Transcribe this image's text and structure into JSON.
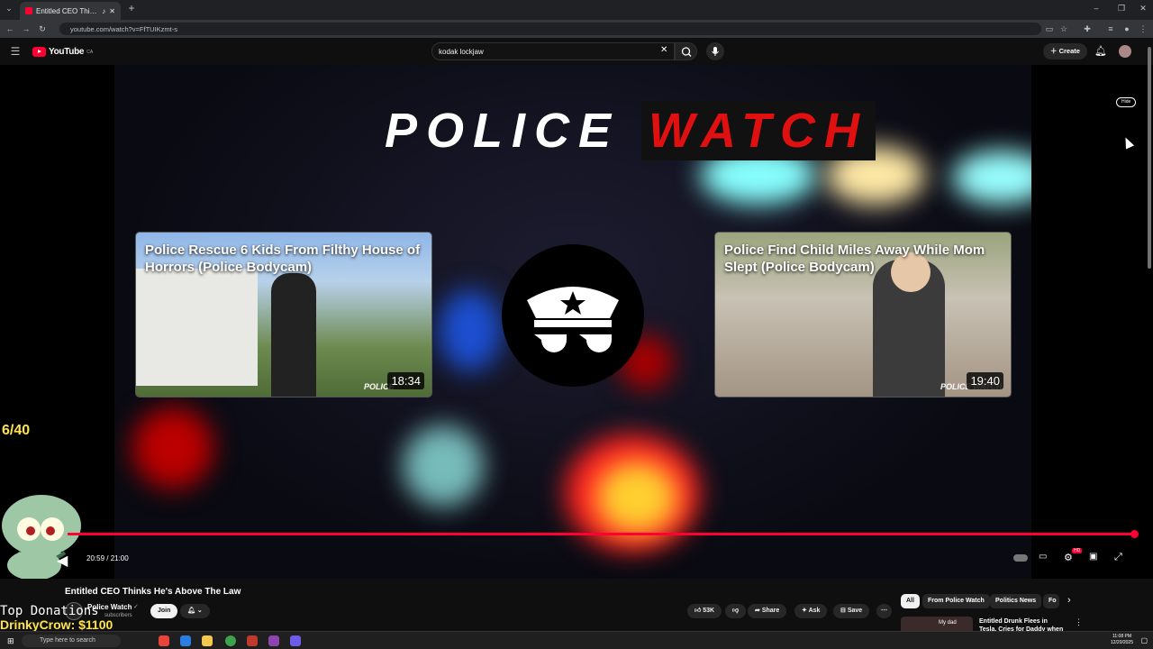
{
  "browser": {
    "tab_title": "Entitled CEO Thinks He's A...",
    "url": "youtube.com/watch?v=FfTUIKzmt-s"
  },
  "youtube": {
    "logo_text": "YouTube",
    "region": "CA",
    "search_value": "kodak lockjaw",
    "create_label": "Create"
  },
  "player": {
    "brand_left": "POLICE",
    "brand_right": "WATCH",
    "end_cards": [
      {
        "title": "Police Rescue 6 Kids From Filthy House of Horrors (Police Bodycam)",
        "duration": "18:34",
        "watermark": "POLICE"
      },
      {
        "title": "Police Find Child Miles Away While Mom Slept (Police Bodycam)",
        "duration": "19:40",
        "watermark": "POLICE WATCH"
      }
    ],
    "hide_label": "Hide",
    "time": "20:59 / 21:00",
    "progress_fraction": 0.9992,
    "overlay_counter": "6/40",
    "hd_badge": "HD"
  },
  "video": {
    "title": "Entitled CEO Thinks He's Above The Law",
    "channel": "Police Watch",
    "subscribers": "subscribers",
    "join_label": "Join",
    "likes": "53K",
    "share_label": "Share",
    "ask_label": "Ask",
    "save_label": "Save"
  },
  "chips": [
    "All",
    "From Police Watch",
    "Politics News",
    "Fo"
  ],
  "recommendation": {
    "title": "Entitled Drunk Flees in Tesla, Cries for Daddy when Caught",
    "thumb_text": "My dad"
  },
  "stream_overlay": {
    "heading": "Top Donations",
    "donor": "DrinkyCrow: $1100"
  },
  "taskbar": {
    "search_placeholder": "Type here to search",
    "time": "11:08 PM",
    "date": "12/20/2025"
  },
  "colors": {
    "youtube_red": "#ff0033",
    "police_red": "#e01010",
    "counter_yellow": "#ffe34d"
  }
}
